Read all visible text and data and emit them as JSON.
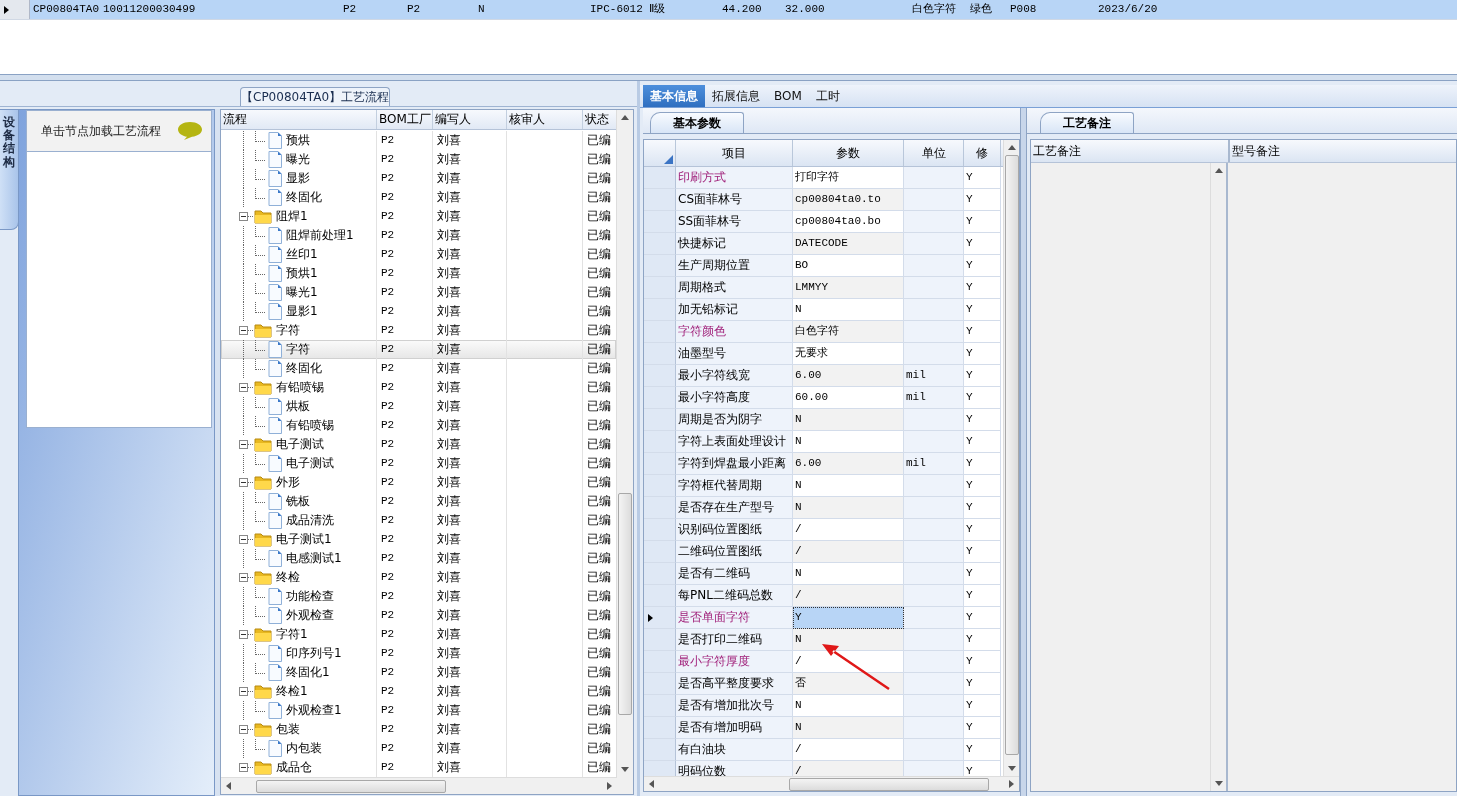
{
  "top_row": {
    "selected": true,
    "cells": [
      "CP00804TA0",
      "10011200030499",
      "P2",
      "P2",
      "N",
      "IPC-6012 Ⅱ级",
      "44.200",
      "32.000",
      "白色字符",
      "绿色",
      "P008",
      "2023/6/20"
    ]
  },
  "process": {
    "title": "【CP00804TA0】工艺流程",
    "side_tab": "设备结构",
    "hint": "单击节点加载工艺流程",
    "columns": [
      "流程",
      "BOM工厂",
      "编写人",
      "核审人",
      "状态"
    ],
    "tree": [
      {
        "children": [
          {
            "label": "预烘",
            "kind": "file",
            "bom": "P2",
            "writer": "刘喜",
            "status": "已编",
            "selected": false
          },
          {
            "label": "曝光",
            "kind": "file",
            "bom": "P2",
            "writer": "刘喜",
            "status": "已编",
            "selected": false
          },
          {
            "label": "显影",
            "kind": "file",
            "bom": "P2",
            "writer": "刘喜",
            "status": "已编",
            "selected": false
          },
          {
            "label": "终固化",
            "kind": "file",
            "bom": "P2",
            "writer": "刘喜",
            "status": "已编",
            "selected": false
          }
        ]
      },
      {
        "label": "阻焊1",
        "kind": "folder",
        "expanded": true,
        "bom": "P2",
        "writer": "刘喜",
        "status": "已编",
        "selected": false,
        "children": [
          {
            "label": "阻焊前处理1",
            "kind": "file",
            "bom": "P2",
            "writer": "刘喜",
            "status": "已编",
            "selected": false
          },
          {
            "label": "丝印1",
            "kind": "file",
            "bom": "P2",
            "writer": "刘喜",
            "status": "已编",
            "selected": false
          },
          {
            "label": "预烘1",
            "kind": "file",
            "bom": "P2",
            "writer": "刘喜",
            "status": "已编",
            "selected": false
          },
          {
            "label": "曝光1",
            "kind": "file",
            "bom": "P2",
            "writer": "刘喜",
            "status": "已编",
            "selected": false
          },
          {
            "label": "显影1",
            "kind": "file",
            "bom": "P2",
            "writer": "刘喜",
            "status": "已编",
            "selected": false
          }
        ]
      },
      {
        "label": "字符",
        "kind": "folder",
        "expanded": true,
        "bom": "P2",
        "writer": "刘喜",
        "status": "已编",
        "selected": false,
        "children": [
          {
            "label": "字符",
            "kind": "file",
            "bom": "P2",
            "writer": "刘喜",
            "status": "已编",
            "selected": true
          },
          {
            "label": "终固化",
            "kind": "file",
            "bom": "P2",
            "writer": "刘喜",
            "status": "已编",
            "selected": false
          }
        ]
      },
      {
        "label": "有铅喷锡",
        "kind": "folder",
        "expanded": true,
        "bom": "P2",
        "writer": "刘喜",
        "status": "已编",
        "selected": false,
        "children": [
          {
            "label": "烘板",
            "kind": "file",
            "bom": "P2",
            "writer": "刘喜",
            "status": "已编",
            "selected": false
          },
          {
            "label": "有铅喷锡",
            "kind": "file",
            "bom": "P2",
            "writer": "刘喜",
            "status": "已编",
            "selected": false
          }
        ]
      },
      {
        "label": "电子测试",
        "kind": "folder",
        "expanded": true,
        "bom": "P2",
        "writer": "刘喜",
        "status": "已编",
        "selected": false,
        "children": [
          {
            "label": "电子测试",
            "kind": "file",
            "bom": "P2",
            "writer": "刘喜",
            "status": "已编",
            "selected": false
          }
        ]
      },
      {
        "label": "外形",
        "kind": "folder",
        "expanded": true,
        "bom": "P2",
        "writer": "刘喜",
        "status": "已编",
        "selected": false,
        "children": [
          {
            "label": "铣板",
            "kind": "file",
            "bom": "P2",
            "writer": "刘喜",
            "status": "已编",
            "selected": false
          },
          {
            "label": "成品清洗",
            "kind": "file",
            "bom": "P2",
            "writer": "刘喜",
            "status": "已编",
            "selected": false
          }
        ]
      },
      {
        "label": "电子测试1",
        "kind": "folder",
        "expanded": true,
        "bom": "P2",
        "writer": "刘喜",
        "status": "已编",
        "selected": false,
        "children": [
          {
            "label": "电感测试1",
            "kind": "file",
            "bom": "P2",
            "writer": "刘喜",
            "status": "已编",
            "selected": false
          }
        ]
      },
      {
        "label": "终检",
        "kind": "folder",
        "expanded": true,
        "bom": "P2",
        "writer": "刘喜",
        "status": "已编",
        "selected": false,
        "children": [
          {
            "label": "功能检查",
            "kind": "file",
            "bom": "P2",
            "writer": "刘喜",
            "status": "已编",
            "selected": false
          },
          {
            "label": "外观检查",
            "kind": "file",
            "bom": "P2",
            "writer": "刘喜",
            "status": "已编",
            "selected": false
          }
        ]
      },
      {
        "label": "字符1",
        "kind": "folder",
        "expanded": true,
        "bom": "P2",
        "writer": "刘喜",
        "status": "已编",
        "selected": false,
        "children": [
          {
            "label": "印序列号1",
            "kind": "file",
            "bom": "P2",
            "writer": "刘喜",
            "status": "已编",
            "selected": false
          },
          {
            "label": "终固化1",
            "kind": "file",
            "bom": "P2",
            "writer": "刘喜",
            "status": "已编",
            "selected": false
          }
        ]
      },
      {
        "label": "终检1",
        "kind": "folder",
        "expanded": true,
        "bom": "P2",
        "writer": "刘喜",
        "status": "已编",
        "selected": false,
        "children": [
          {
            "label": "外观检查1",
            "kind": "file",
            "bom": "P2",
            "writer": "刘喜",
            "status": "已编",
            "selected": false
          }
        ]
      },
      {
        "label": "包装",
        "kind": "folder",
        "expanded": true,
        "bom": "P2",
        "writer": "刘喜",
        "status": "已编",
        "selected": false,
        "children": [
          {
            "label": "内包装",
            "kind": "file",
            "bom": "P2",
            "writer": "刘喜",
            "status": "已编",
            "selected": false
          }
        ]
      },
      {
        "label": "成品仓",
        "kind": "folder",
        "expanded": true,
        "bom": "P2",
        "writer": "刘喜",
        "status": "已编",
        "selected": false
      }
    ]
  },
  "detail_tabs": [
    {
      "label": "基本信息",
      "selected": true
    },
    {
      "label": "拓展信息",
      "selected": false
    },
    {
      "label": "BOM",
      "selected": false
    },
    {
      "label": "工时",
      "selected": false
    }
  ],
  "basic_params": {
    "tab": "基本参数",
    "columns": [
      "项目",
      "参数",
      "单位",
      "修"
    ],
    "rows": [
      {
        "item": "印刷方式",
        "value": "打印字符",
        "modified": "Y",
        "kind": "marked",
        "selected": false
      },
      {
        "item": "CS面菲林号",
        "value": "cp00804ta0.to",
        "modified": "Y",
        "kind": "plain",
        "selected": false
      },
      {
        "item": "SS面菲林号",
        "value": "cp00804ta0.bo",
        "modified": "Y",
        "kind": "plain",
        "selected": false
      },
      {
        "item": "快捷标记",
        "value": "DATECODE",
        "modified": "Y",
        "kind": "plain",
        "selected": false
      },
      {
        "item": "生产周期位置",
        "value": "BO",
        "modified": "Y",
        "kind": "plain",
        "selected": false
      },
      {
        "item": "周期格式",
        "value": "LMMYY",
        "modified": "Y",
        "kind": "plain",
        "selected": false
      },
      {
        "item": "加无铅标记",
        "value": "N",
        "modified": "Y",
        "kind": "plain",
        "selected": false
      },
      {
        "item": "字符颜色",
        "value": "白色字符",
        "modified": "Y",
        "kind": "marked",
        "selected": false
      },
      {
        "item": "油墨型号",
        "value": "无要求",
        "modified": "Y",
        "kind": "plain",
        "selected": false
      },
      {
        "item": "最小字符线宽",
        "value": "6.00",
        "unit": "mil",
        "modified": "Y",
        "kind": "plain",
        "selected": false
      },
      {
        "item": "最小字符高度",
        "value": "60.00",
        "unit": "mil",
        "modified": "Y",
        "kind": "plain",
        "selected": false
      },
      {
        "item": "周期是否为阴字",
        "value": "N",
        "modified": "Y",
        "kind": "plain",
        "selected": false
      },
      {
        "item": "字符上表面处理设计",
        "value": "N",
        "modified": "Y",
        "kind": "plain",
        "selected": false
      },
      {
        "item": "字符到焊盘最小距离",
        "value": "6.00",
        "unit": "mil",
        "modified": "Y",
        "kind": "plain",
        "selected": false
      },
      {
        "item": "字符框代替周期",
        "value": "N",
        "modified": "Y",
        "kind": "plain",
        "selected": false
      },
      {
        "item": "是否存在生产型号",
        "value": "N",
        "modified": "Y",
        "kind": "plain",
        "selected": false
      },
      {
        "item": "识别码位置图纸",
        "value": "/",
        "modified": "Y",
        "kind": "plain",
        "selected": false
      },
      {
        "item": "二维码位置图纸",
        "value": "/",
        "modified": "Y",
        "kind": "plain",
        "selected": false
      },
      {
        "item": "是否有二维码",
        "value": "N",
        "modified": "Y",
        "kind": "plain",
        "selected": false
      },
      {
        "item": "每PNL二维码总数",
        "value": "/",
        "modified": "Y",
        "kind": "plain",
        "selected": false
      },
      {
        "item": "是否单面字符",
        "value": "Y",
        "modified": "Y",
        "kind": "marked",
        "selected": true
      },
      {
        "item": "是否打印二维码",
        "value": "N",
        "modified": "Y",
        "kind": "plain",
        "selected": false
      },
      {
        "item": "最小字符厚度",
        "value": "/",
        "modified": "Y",
        "kind": "marked",
        "selected": false
      },
      {
        "item": "是否高平整度要求",
        "value": "否",
        "modified": "Y",
        "kind": "plain",
        "selected": false
      },
      {
        "item": "是否有增加批次号",
        "value": "N",
        "modified": "Y",
        "kind": "plain",
        "selected": false
      },
      {
        "item": "是否有增加明码",
        "value": "N",
        "modified": "Y",
        "kind": "plain",
        "selected": false
      },
      {
        "item": "有白油块",
        "value": "/",
        "modified": "Y",
        "kind": "plain",
        "selected": false
      },
      {
        "item": "明码位数",
        "value": "/",
        "modified": "Y",
        "kind": "plain",
        "selected": false
      }
    ]
  },
  "remarks": {
    "tab": "工艺备注",
    "columns": [
      "工艺备注",
      "型号备注"
    ]
  }
}
